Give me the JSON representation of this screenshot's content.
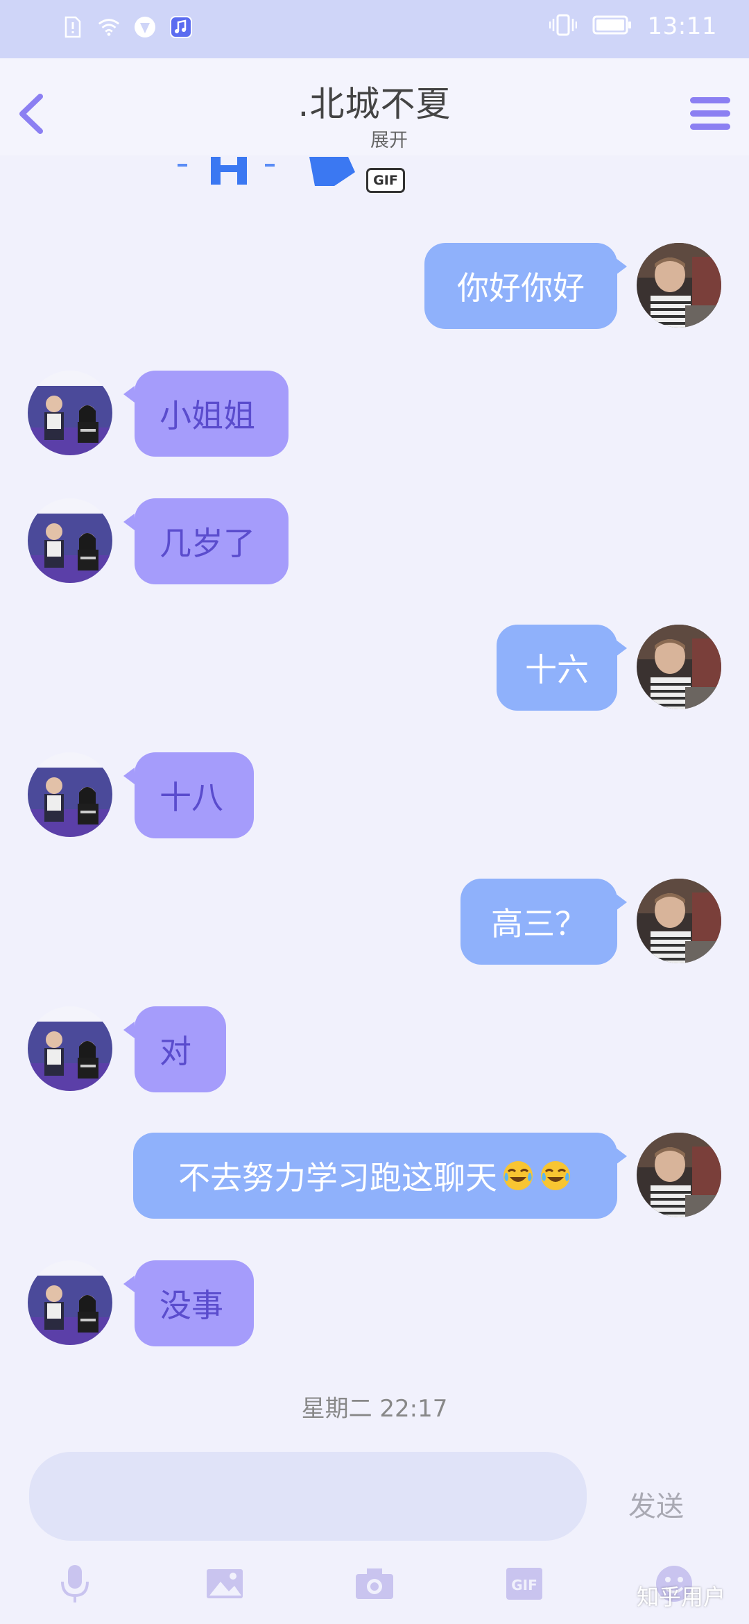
{
  "status_bar": {
    "time": "13:11",
    "icons": [
      "sim-alert-icon",
      "wifi-icon",
      "vpn-icon",
      "music-icon",
      "vibrate-icon",
      "battery-icon"
    ]
  },
  "header": {
    "title": ".北城不夏",
    "subtitle": "展开",
    "back_icon": "chevron-left-icon",
    "menu_icon": "menu-icon"
  },
  "gif_badge": "GIF",
  "messages": [
    {
      "side": "out",
      "text": "你好你好"
    },
    {
      "side": "in",
      "text": "小姐姐"
    },
    {
      "side": "in",
      "text": "几岁了"
    },
    {
      "side": "out",
      "text": "十六"
    },
    {
      "side": "in",
      "text": "十八"
    },
    {
      "side": "out",
      "text": "高三？"
    },
    {
      "side": "in",
      "text": "对"
    },
    {
      "side": "out",
      "text": "不去努力学习跑这聊天",
      "emoji": [
        "😂",
        "😂"
      ]
    },
    {
      "side": "in",
      "text": "没事"
    }
  ],
  "timestamp": "星期二 22:17",
  "input": {
    "placeholder": ""
  },
  "send_label": "发送",
  "toolbar": [
    "microphone-icon",
    "image-icon",
    "camera-icon",
    "gif-icon",
    "emoji-icon"
  ],
  "toolbar_gif_label": "GIF",
  "watermark": "知乎用户",
  "colors": {
    "status_bar": "#cfd5f8",
    "background": "#f1f1fc",
    "outgoing_bubble": "#8fb1fb",
    "incoming_bubble": "#a59cfb",
    "incoming_text": "#5a4ccd",
    "accent": "#8b7ff2"
  }
}
